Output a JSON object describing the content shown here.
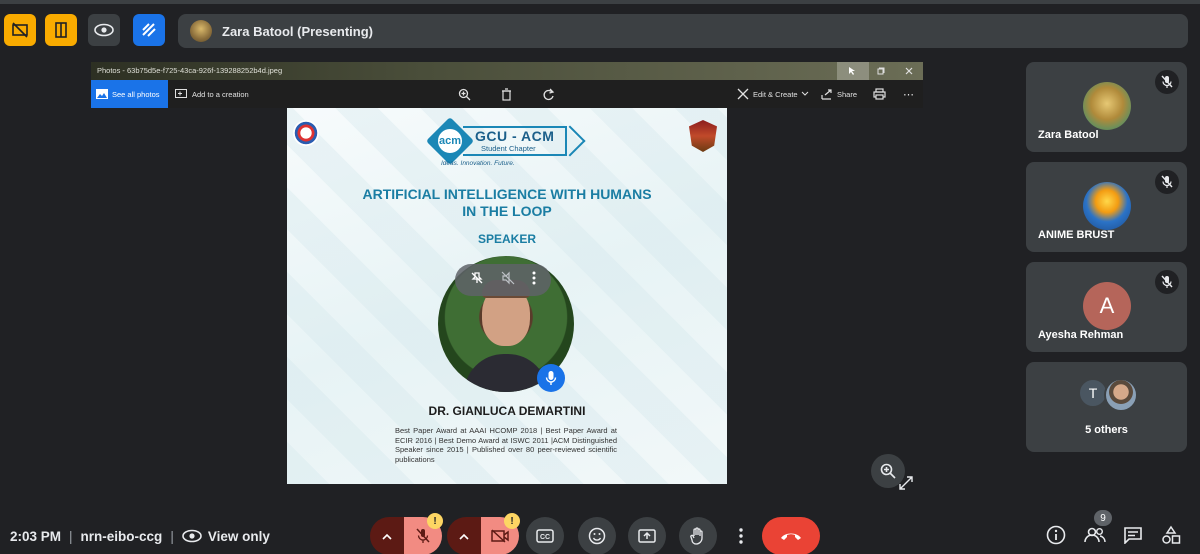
{
  "top": {
    "presenter_name": "Zara Batool (Presenting)"
  },
  "photos": {
    "file_name": "Photos - 63b75d5e-f725-43ca-926f-139288252b4d.jpeg",
    "see_all_label": "See all photos",
    "add_to_creation_label": "Add to a creation",
    "edit_create_label": "Edit & Create",
    "share_label": "Share"
  },
  "poster": {
    "org_title": "GCU - ACM",
    "org_sub": "Student Chapter",
    "acm_mark": "acm",
    "tagline": "Ideas. Innovation. Future.",
    "title_line1": "ARTIFICIAL INTELLIGENCE WITH HUMANS",
    "title_line2": "IN THE LOOP",
    "speaker_label": "SPEAKER",
    "speaker_name": "DR. GIANLUCA DEMARTINI",
    "bio": "Best Paper Award at AAAI HCOMP 2018 | Best Paper Award at ECIR 2016 | Best Demo Award at ISWC 2011 |ACM Distinguished Speaker since 2015 | Published over 80 peer-reviewed scientific publications"
  },
  "participants": [
    {
      "name": "Zara Batool",
      "avatar": "photo"
    },
    {
      "name": "ANIME BRUST",
      "avatar": "photo"
    },
    {
      "name": "Ayesha Rehman",
      "avatar_letter": "A"
    }
  ],
  "others": {
    "label": "5 others",
    "avatar_letter": "T"
  },
  "bottom": {
    "time": "2:03 PM",
    "meeting_code": "nrn-eibo-ccg",
    "view_only": "View only",
    "participant_count": "9",
    "warn_mark": "!"
  },
  "colors": {
    "background": "#202124",
    "tile": "#3c4043",
    "accent_blue": "#1a73e8",
    "warning_yellow": "#f9ab00",
    "end_call_red": "#ea4335",
    "mic_off_pink": "#f28b82",
    "poster_blue": "#1a7da3"
  }
}
